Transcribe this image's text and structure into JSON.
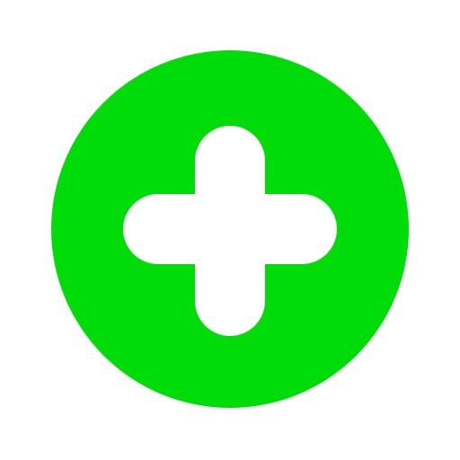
{
  "icon": {
    "name": "plus-icon",
    "shape": "circle-with-plus",
    "background_color": "#00DC0A",
    "foreground_color": "#FFFFFF",
    "page_background": "#FFFFFF"
  }
}
